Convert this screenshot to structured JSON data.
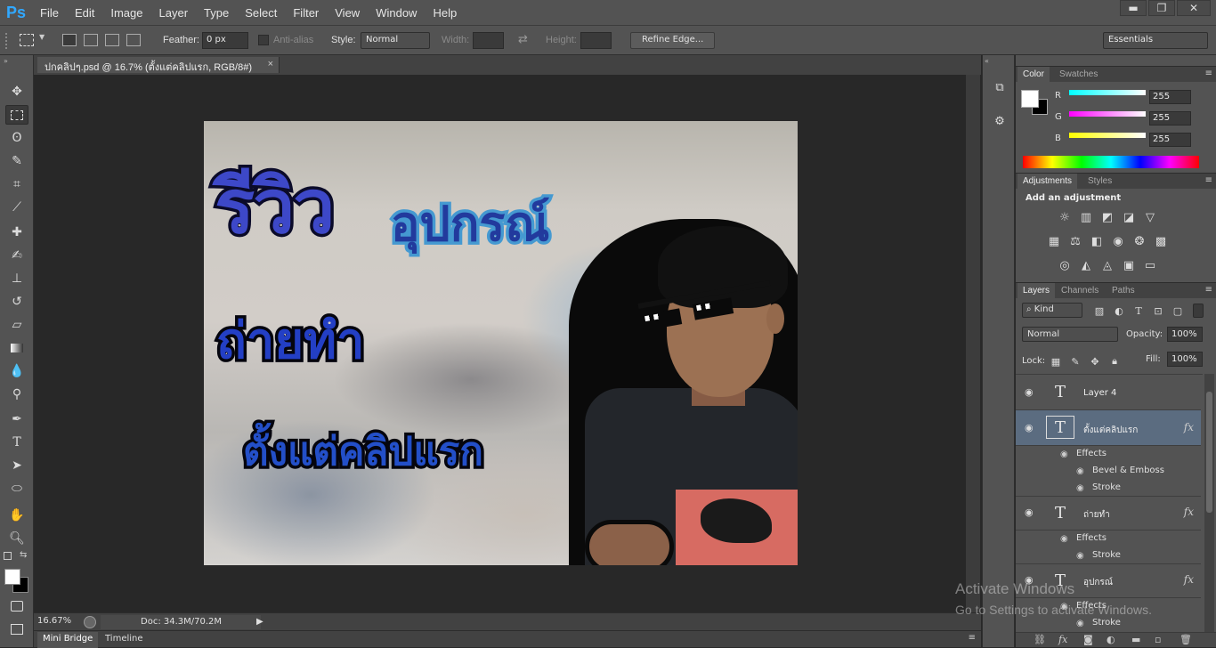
{
  "app": {
    "logo": "Ps"
  },
  "menu": [
    "File",
    "Edit",
    "Image",
    "Layer",
    "Type",
    "Select",
    "Filter",
    "View",
    "Window",
    "Help"
  ],
  "window_controls": {
    "minimize": "▬",
    "restore": "❐",
    "close": "✕"
  },
  "options": {
    "feather_label": "Feather:",
    "feather_value": "0 px",
    "antialias_label": "Anti-alias",
    "style_label": "Style:",
    "style_value": "Normal",
    "width_label": "Width:",
    "height_label": "Height:",
    "refine_edge": "Refine Edge...",
    "workspace": "Essentials"
  },
  "document": {
    "tab_title": "ปกคลิปๆ.psd @ 16.7% (ตั้งแต่คลิปแรก, RGB/8#)",
    "close": "×",
    "artwork_text": {
      "review": "รีวิว",
      "equipment": "อุปกรณ์",
      "shoot": "ถ่ายทำ",
      "since_first": "ตั้งแต่คลิปแรก"
    }
  },
  "status": {
    "zoom": "16.67%",
    "doc": "Doc: 34.3M/70.2M"
  },
  "bottom_tabs": [
    "Mini Bridge",
    "Timeline"
  ],
  "color_panel": {
    "tabs": [
      "Color",
      "Swatches"
    ],
    "channels": [
      {
        "label": "R",
        "value": "255",
        "color": "#00ffff"
      },
      {
        "label": "G",
        "value": "255",
        "color": "#ff00ff"
      },
      {
        "label": "B",
        "value": "255",
        "color": "#ffff00"
      }
    ]
  },
  "adjustments_panel": {
    "tabs": [
      "Adjustments",
      "Styles"
    ],
    "title": "Add an adjustment"
  },
  "layers_panel": {
    "tabs": [
      "Layers",
      "Channels",
      "Paths"
    ],
    "filter": "Kind",
    "blend_mode": "Normal",
    "opacity_label": "Opacity:",
    "opacity": "100%",
    "lock_label": "Lock:",
    "fill_label": "Fill:",
    "fill": "100%",
    "layers": [
      {
        "name": "Layer 4"
      },
      {
        "name": "ตั้งแต่คลิปแรก",
        "effects_label": "Effects",
        "effects": [
          "Bevel & Emboss",
          "Stroke"
        ]
      },
      {
        "name": "ถ่ายทำ",
        "effects_label": "Effects",
        "effects": [
          "Stroke"
        ]
      },
      {
        "name": "อุปกรณ์",
        "effects_label": "Effects",
        "effects": [
          "Stroke"
        ]
      }
    ]
  },
  "watermark": {
    "line1": "Activate Windows",
    "line2": "Go to Settings to activate Windows."
  },
  "colors": {
    "accent": "#31a8ff",
    "panel": "#535353",
    "canvas_bg": "#282828",
    "selected_layer": "#5b6c80"
  }
}
